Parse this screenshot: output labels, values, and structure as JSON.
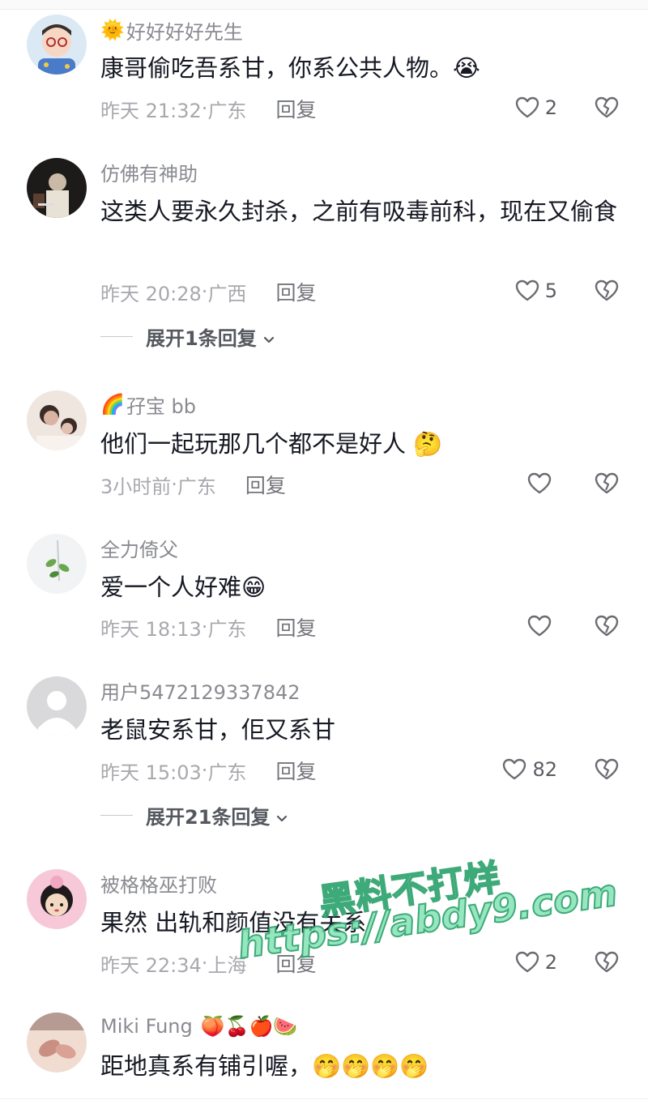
{
  "comments": [
    {
      "username": "好好好好先生",
      "username_prefix_icon": "sun-emoji",
      "username_prefix": "🌞",
      "username_suffix": "",
      "text": "康哥偷吃吾系甘，你系公共人物。😭",
      "time": "昨天 21:32",
      "location": "广东",
      "reply_label": "回复",
      "likes": "2",
      "avatar_colors": [
        "#dbe9f5",
        "#f6d7c3",
        "#3a2f2a"
      ]
    },
    {
      "username": "仿佛有神助",
      "username_prefix": "",
      "username_suffix": "",
      "text": "这类人要永久封杀，之前有吸毒前科，现在又偷食",
      "time": "昨天 20:28",
      "location": "广西",
      "reply_label": "回复",
      "likes": "5",
      "expand_label": "展开1条回复",
      "avatar_colors": [
        "#1d1a1a",
        "#c9b9a6",
        "#5a4030"
      ]
    },
    {
      "username": "孖宝 bb",
      "username_prefix_icon": "rainbow-emoji",
      "username_prefix": "🌈",
      "username_suffix": "",
      "text": "他们一起玩那几个都不是好人 🤔",
      "time": "3小时前",
      "location": "广东",
      "reply_label": "回复",
      "likes": "",
      "avatar_colors": [
        "#efe6e0",
        "#d9b3a4",
        "#3b2b25"
      ]
    },
    {
      "username": "全力倚父",
      "username_prefix": "",
      "username_suffix": "",
      "text": "爱一个人好难😁",
      "time": "昨天 18:13",
      "location": "广东",
      "reply_label": "回复",
      "likes": "",
      "avatar_colors": [
        "#f2f3f4",
        "#6aa84f",
        "#c8ccd0"
      ]
    },
    {
      "username": "用户5472129337842",
      "username_prefix": "",
      "username_suffix": "",
      "text": "老鼠安系甘，佢又系甘",
      "time": "昨天 15:03",
      "location": "广东",
      "reply_label": "回复",
      "likes": "82",
      "expand_label": "展开21条回复",
      "avatar_colors": [
        "#d9d9dc",
        "#ffffff",
        "#ffffff"
      ]
    },
    {
      "username": "被格格巫打败",
      "username_prefix": "",
      "username_suffix": "",
      "text": "果然 出轨和颜值没有关系",
      "time": "昨天 22:34",
      "location": "上海",
      "reply_label": "回复",
      "likes": "2",
      "avatar_colors": [
        "#f7c8d8",
        "#1f1b1b",
        "#f3d9c4"
      ]
    },
    {
      "username": "Miki Fung",
      "username_prefix": "",
      "username_suffix": "🍑🍒🍎🍉",
      "text": "距地真系有铺引喔，🤭🤭🤭🤭",
      "time": "",
      "location": "",
      "reply_label": "",
      "likes": "",
      "avatar_colors": [
        "#f1dcd2",
        "#c98f82",
        "#7a5a4f"
      ]
    }
  ],
  "watermark": {
    "line1": "黑料不打烊",
    "line2": "https://abdy9.com"
  },
  "colors": {
    "text_primary": "#161823",
    "text_secondary": "#8a8b91",
    "meta": "#a8a9ae",
    "watermark_fill": "#8ee6ba",
    "watermark_stroke": "#2fa36e"
  },
  "icons": {
    "like": "heart-outline-icon",
    "dislike": "broken-heart-icon",
    "expand": "chevron-down-icon"
  }
}
